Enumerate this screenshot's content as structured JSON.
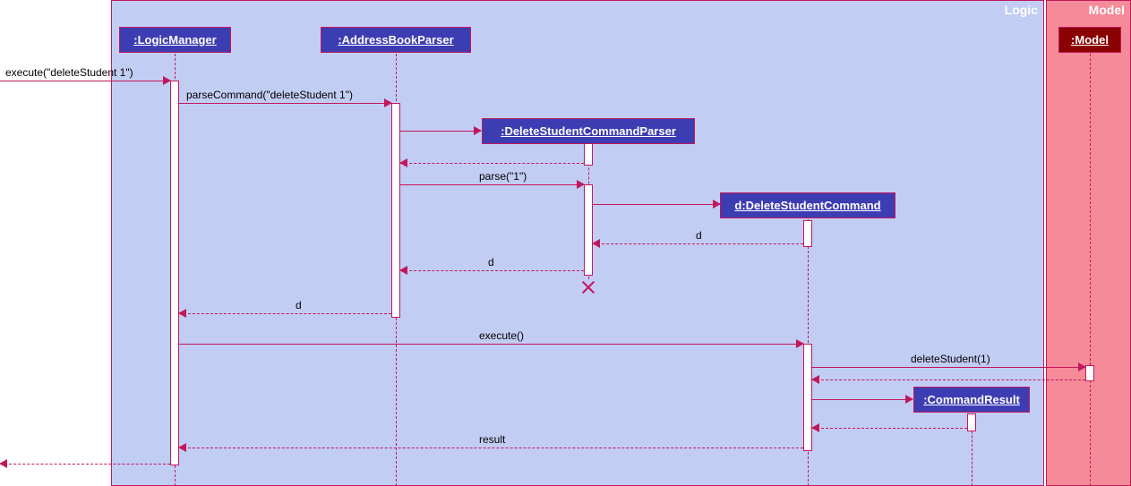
{
  "frames": {
    "logic": {
      "title": "Logic"
    },
    "model": {
      "title": "Model"
    }
  },
  "lifelines": {
    "logicManager": ":LogicManager",
    "abParser": ":AddressBookParser",
    "dscParser": ":DeleteStudentCommandParser",
    "dsCommand": "d:DeleteStudentCommand",
    "cmdResult": ":CommandResult",
    "model": ":Model"
  },
  "messages": {
    "execInitial": "execute(\"deleteStudent 1\")",
    "parseCommand": "parseCommand(\"deleteStudent 1\")",
    "parse": "parse(\"1\")",
    "return_d1": "d",
    "return_d2": "d",
    "return_d3": "d",
    "execute": "execute()",
    "deleteStudent": "deleteStudent(1)",
    "result": "result"
  }
}
